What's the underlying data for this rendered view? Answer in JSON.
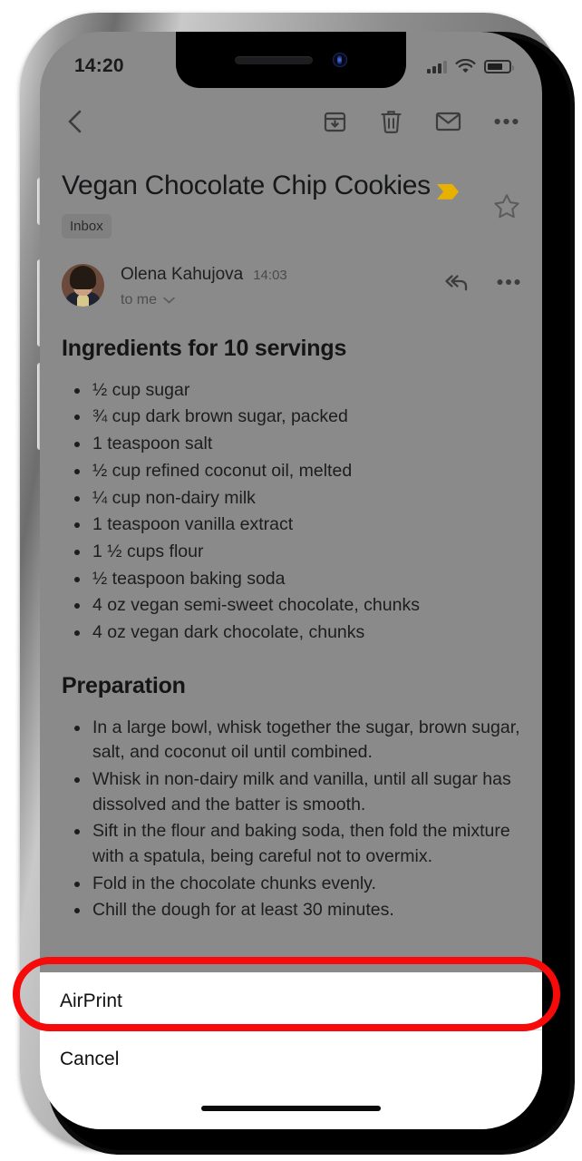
{
  "status_bar": {
    "time": "14:20",
    "signal_icon": "cellular-signal-icon",
    "wifi_icon": "wifi-icon",
    "battery_icon": "battery-icon"
  },
  "toolbar": {
    "back_icon": "back-chevron-icon",
    "archive_icon": "archive-icon",
    "delete_icon": "trash-icon",
    "mark_unread_icon": "envelope-icon",
    "more_icon": "more-options-icon"
  },
  "email": {
    "subject": "Vegan Chocolate Chip Cookies",
    "important_marker_icon": "important-chevron-icon",
    "important_marker_color": "#e8b100",
    "star_icon": "star-outline-icon",
    "label": "Inbox",
    "sender_name": "Olena Kahujova",
    "sender_time": "14:03",
    "recipients": "to me",
    "recipients_expand_icon": "chevron-down-icon",
    "reply_all_icon": "reply-all-icon",
    "message_more_icon": "more-options-icon",
    "avatar": "sender-avatar"
  },
  "content": {
    "ingredients_heading": "Ingredients for 10 servings",
    "ingredients": [
      "½ cup sugar",
      "¾ cup dark brown sugar, packed",
      "1 teaspoon salt",
      "½ cup refined coconut oil, melted",
      "¼ cup non-dairy milk",
      "1 teaspoon vanilla extract",
      "1 ½ cups flour",
      "½ teaspoon baking soda",
      "4 oz vegan semi-sweet chocolate, chunks",
      "4 oz vegan dark chocolate, chunks"
    ],
    "preparation_heading": "Preparation",
    "preparation": [
      "In a large bowl, whisk together the sugar, brown sugar, salt, and coconut oil until combined.",
      "Whisk in non-dairy milk and vanilla, until all sugar has dissolved and the batter is smooth.",
      "Sift in the flour and baking soda, then fold the mixture with a spatula, being careful not to overmix.",
      "Fold in the chocolate chunks evenly.",
      "Chill the dough for at least 30 minutes."
    ]
  },
  "action_sheet": {
    "items": [
      {
        "label": "AirPrint",
        "highlighted": true
      },
      {
        "label": "Cancel",
        "highlighted": false
      }
    ]
  },
  "annotation": {
    "color": "#f60a0a",
    "target": "AirPrint"
  }
}
